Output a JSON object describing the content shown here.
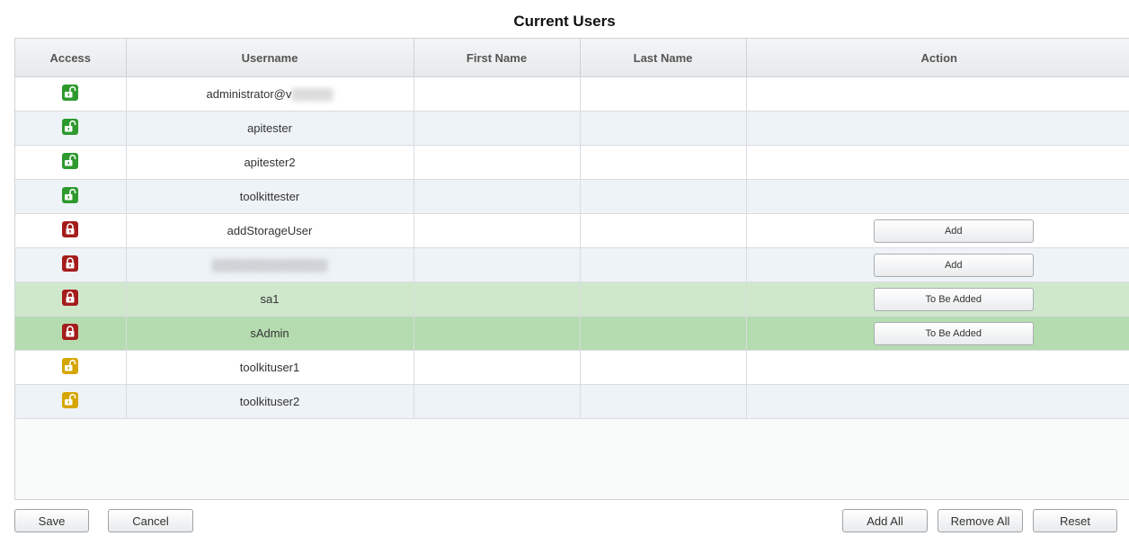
{
  "title": "Current Users",
  "columns": {
    "access": "Access",
    "username": "Username",
    "first_name": "First Name",
    "last_name": "Last Name",
    "action": "Action"
  },
  "colors": {
    "unlocked": "#2e9a2e",
    "locked": "#a51c1c",
    "limited": "#d6a600",
    "added_row": "#cfe8cc",
    "added_row_selected": "#b5dcb0"
  },
  "rows": [
    {
      "access": "unlocked-green",
      "access_icon": "unlocked-icon",
      "username": "administrator@v",
      "first_name": "",
      "last_name": "",
      "action": ""
    },
    {
      "access": "unlocked-green",
      "access_icon": "unlocked-icon",
      "username": "apitester",
      "first_name": "",
      "last_name": "",
      "action": ""
    },
    {
      "access": "unlocked-green",
      "access_icon": "unlocked-icon",
      "username": "apitester2",
      "first_name": "",
      "last_name": "",
      "action": ""
    },
    {
      "access": "unlocked-green",
      "access_icon": "unlocked-icon",
      "username": "toolkittester",
      "first_name": "",
      "last_name": "",
      "action": ""
    },
    {
      "access": "locked-red",
      "access_icon": "locked-icon",
      "username": "addStorageUser",
      "first_name": "",
      "last_name": "",
      "action": "Add"
    },
    {
      "access": "locked-red",
      "access_icon": "locked-icon",
      "username": "",
      "first_name": "",
      "last_name": "",
      "action": "Add"
    },
    {
      "access": "locked-red",
      "access_icon": "locked-icon",
      "username": "sa1",
      "first_name": "",
      "last_name": "",
      "action": "To Be Added"
    },
    {
      "access": "locked-red",
      "access_icon": "locked-icon",
      "username": "sAdmin",
      "first_name": "",
      "last_name": "",
      "action": "To Be Added"
    },
    {
      "access": "unlocked-yellow",
      "access_icon": "unlocked-icon",
      "username": "toolkituser1",
      "first_name": "",
      "last_name": "",
      "action": ""
    },
    {
      "access": "unlocked-yellow",
      "access_icon": "unlocked-icon",
      "username": "toolkituser2",
      "first_name": "",
      "last_name": "",
      "action": ""
    }
  ],
  "buttons": {
    "save": "Save",
    "cancel": "Cancel",
    "add_all": "Add All",
    "remove_all": "Remove All",
    "reset": "Reset"
  }
}
